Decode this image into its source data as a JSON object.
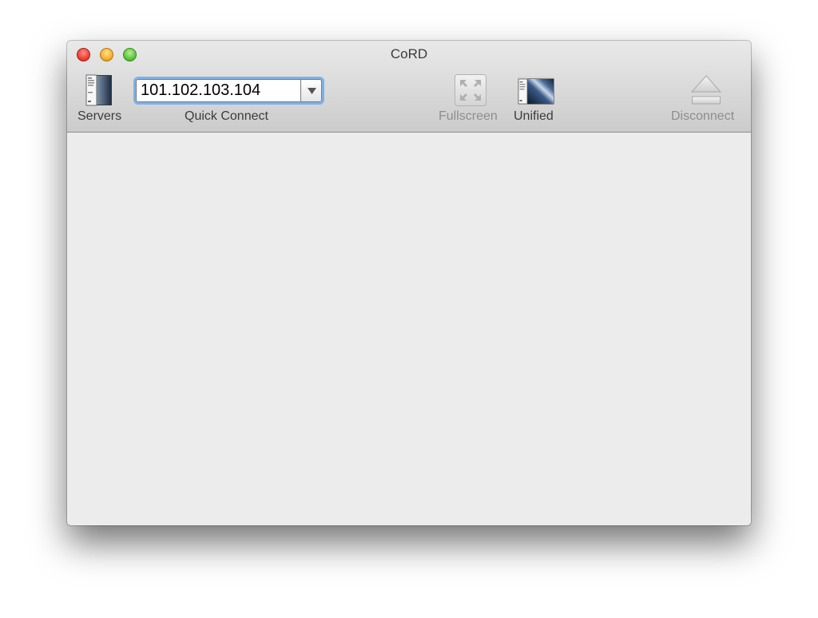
{
  "window": {
    "title": "CoRD"
  },
  "toolbar": {
    "servers_label": "Servers",
    "quick_connect_label": "Quick Connect",
    "quick_connect_value": "101.102.103.104",
    "fullscreen_label": "Fullscreen",
    "unified_label": "Unified",
    "disconnect_label": "Disconnect"
  },
  "icons": {
    "servers": "servers-drawer-icon",
    "dropdown": "triangle-down-icon",
    "fullscreen": "expand-arrows-icon",
    "unified": "unified-window-icon",
    "disconnect": "eject-icon"
  },
  "colors": {
    "close": "#f0463b",
    "minimize": "#f6b53a",
    "zoom": "#64c945",
    "focus_ring": "#7fb0e8",
    "content_bg": "#ececec"
  }
}
